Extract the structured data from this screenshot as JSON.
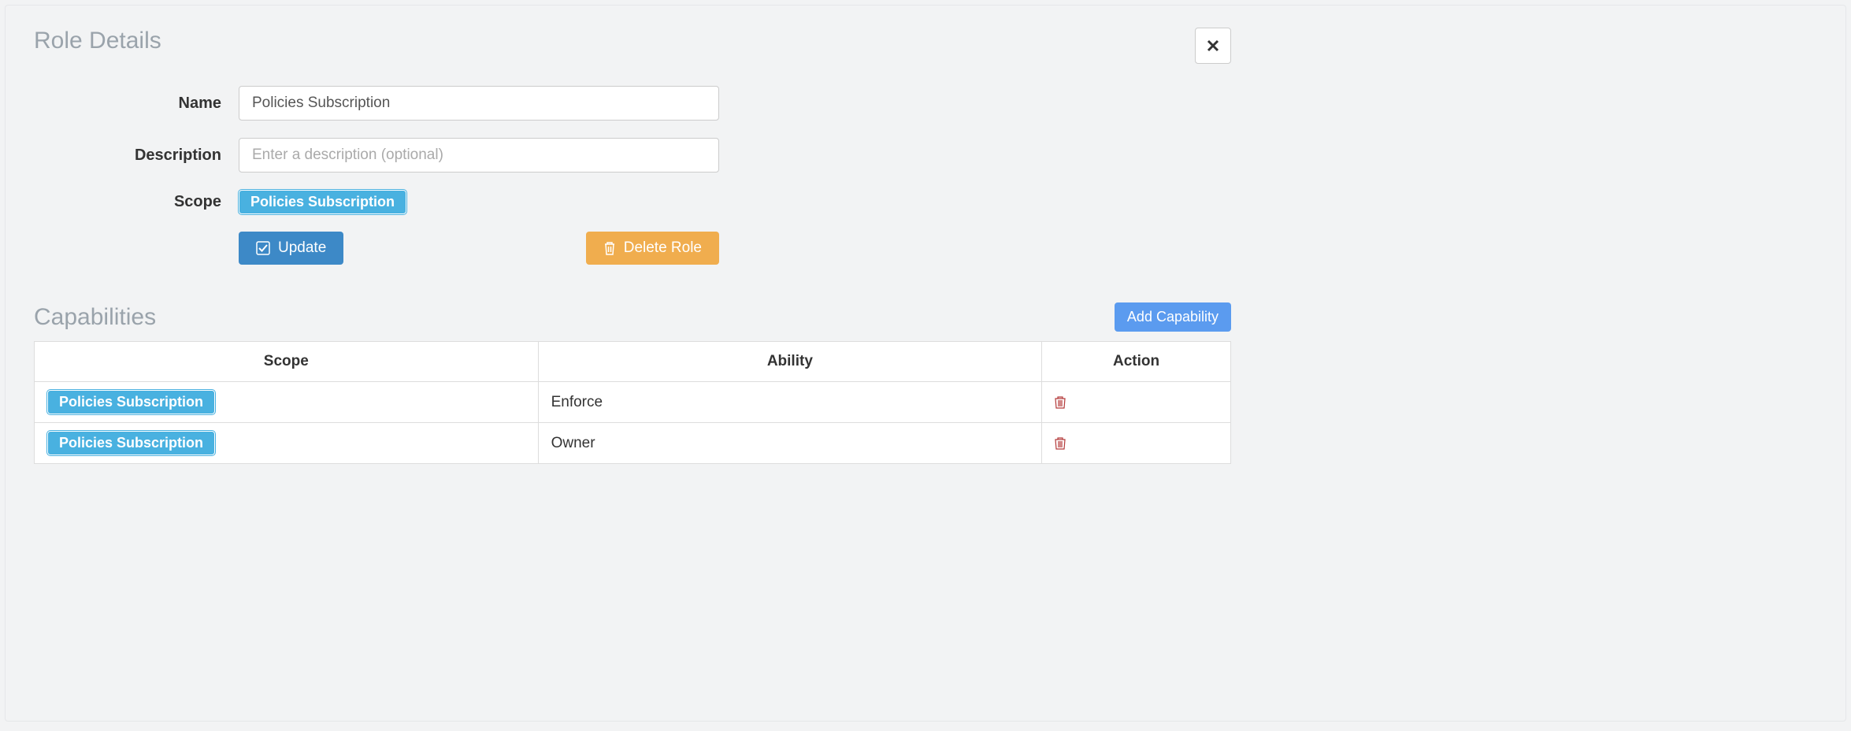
{
  "roleDetails": {
    "title": "Role Details",
    "fields": {
      "nameLabel": "Name",
      "nameValue": "Policies Subscription",
      "descriptionLabel": "Description",
      "descriptionValue": "",
      "descriptionPlaceholder": "Enter a description (optional)",
      "scopeLabel": "Scope",
      "scopeBadge": "Policies Subscription"
    },
    "buttons": {
      "update": "Update",
      "delete": "Delete Role"
    }
  },
  "capabilities": {
    "title": "Capabilities",
    "addButton": "Add Capability",
    "headers": {
      "scope": "Scope",
      "ability": "Ability",
      "action": "Action"
    },
    "rows": [
      {
        "scope": "Policies Subscription",
        "ability": "Enforce"
      },
      {
        "scope": "Policies Subscription",
        "ability": "Owner"
      }
    ]
  }
}
